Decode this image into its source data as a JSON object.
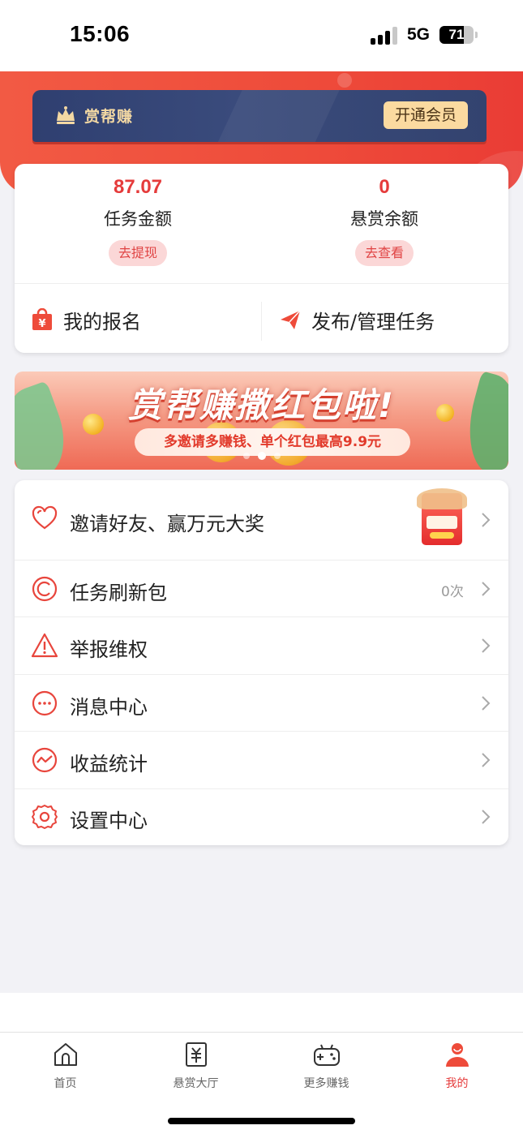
{
  "status_bar": {
    "time": "15:06",
    "network": "5G",
    "battery": "71",
    "battery_level_percent": 71
  },
  "vip": {
    "title": "赏帮赚",
    "button": "开通会员",
    "icon": "crown-icon"
  },
  "stats": {
    "task_amount": {
      "value": "87.07",
      "label": "任务金额",
      "button": "去提现"
    },
    "bounty_balance": {
      "value": "0",
      "label": "悬赏余额",
      "button": "去查看"
    }
  },
  "actions": {
    "my_signup": {
      "label": "我的报名",
      "icon": "shopping-bag-icon"
    },
    "publish": {
      "label": "发布/管理任务",
      "icon": "paper-plane-icon"
    }
  },
  "banner": {
    "title": "赏帮赚撒红包啦!",
    "subtitle": "多邀请多赚钱、单个红包最高9.9元",
    "dots": 3,
    "active_dot": 1
  },
  "menu": [
    {
      "label": "邀请好友、赢万元大奖",
      "icon": "heart-icon",
      "extra": ""
    },
    {
      "label": "任务刷新包",
      "icon": "refresh-c-icon",
      "extra": "0次"
    },
    {
      "label": "举报维权",
      "icon": "warning-icon",
      "extra": ""
    },
    {
      "label": "消息中心",
      "icon": "message-icon",
      "extra": ""
    },
    {
      "label": "收益统计",
      "icon": "trend-icon",
      "extra": ""
    },
    {
      "label": "设置中心",
      "icon": "gear-icon",
      "extra": ""
    }
  ],
  "tabs": [
    {
      "label": "首页",
      "icon": "home-icon",
      "active": false
    },
    {
      "label": "悬赏大厅",
      "icon": "yuan-doc-icon",
      "active": false
    },
    {
      "label": "更多赚钱",
      "icon": "gamepad-icon",
      "active": false
    },
    {
      "label": "我的",
      "icon": "user-icon",
      "active": true
    }
  ],
  "colors": {
    "accent": "#e53b3b",
    "header_red": "#ee4b3a",
    "vip_navy": "#33436f",
    "vip_gold": "#fbdaa0"
  }
}
